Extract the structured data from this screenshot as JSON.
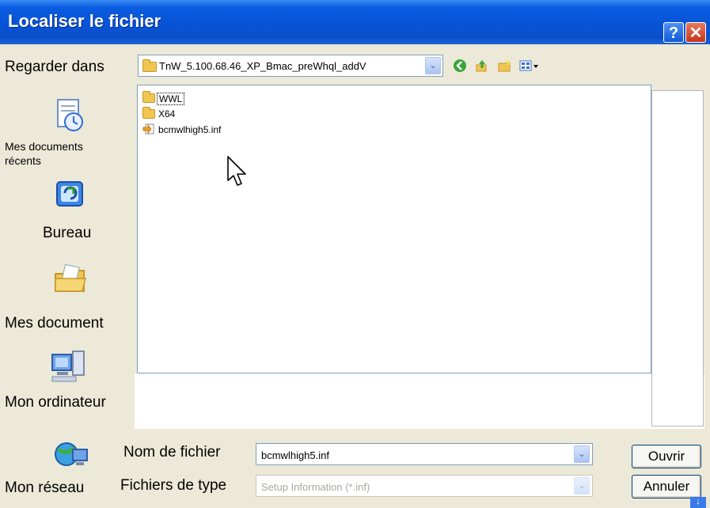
{
  "window": {
    "title": "Localiser le fichier",
    "help_glyph": "?",
    "close_glyph": "✕"
  },
  "lookin": {
    "label": "Regarder dans",
    "value": "TnW_5.100.68.46_XP_Bmac_preWhql_addV",
    "dropdown_glyph": "⌄"
  },
  "toolbar": {
    "back_icon": "back-arrow-icon",
    "up_icon": "up-folder-icon",
    "new_folder_icon": "new-folder-icon",
    "view_menu_icon": "views-menu-icon"
  },
  "places": [
    {
      "label_line1": "Mes documents",
      "label_line2": "récents",
      "icon": "recent-documents-icon"
    },
    {
      "label_line1": "Bureau",
      "label_line2": "",
      "icon": "desktop-icon"
    },
    {
      "label_line1": "Mes document",
      "label_line2": "",
      "icon": "my-documents-icon"
    },
    {
      "label_line1": "Mon ordinateur",
      "label_line2": "",
      "icon": "my-computer-icon"
    },
    {
      "label_line1": "Mon réseau",
      "label_line2": "",
      "icon": "my-network-icon"
    }
  ],
  "files": [
    {
      "name": "WWL",
      "type": "folder",
      "selected": true
    },
    {
      "name": "X64",
      "type": "folder",
      "selected": false
    },
    {
      "name": "bcmwlhigh5.inf",
      "type": "inf-file",
      "selected": false
    }
  ],
  "filename": {
    "label": "Nom de fichier",
    "value": "bcmwlhigh5.inf"
  },
  "filetype": {
    "label": "Fichiers de type",
    "value": "Setup Information (*.inf)"
  },
  "buttons": {
    "open": "Ouvrir",
    "cancel": "Annuler"
  }
}
